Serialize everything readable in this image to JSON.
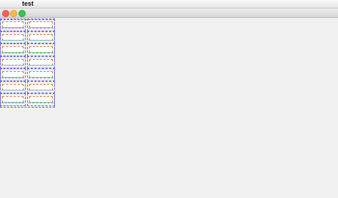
{
  "menubar": {
    "apple_icon": "",
    "app_name": "test"
  },
  "window": {
    "controls": [
      "close",
      "minimize",
      "zoom"
    ]
  },
  "grid": {
    "rows": 7,
    "columns": 2
  }
}
